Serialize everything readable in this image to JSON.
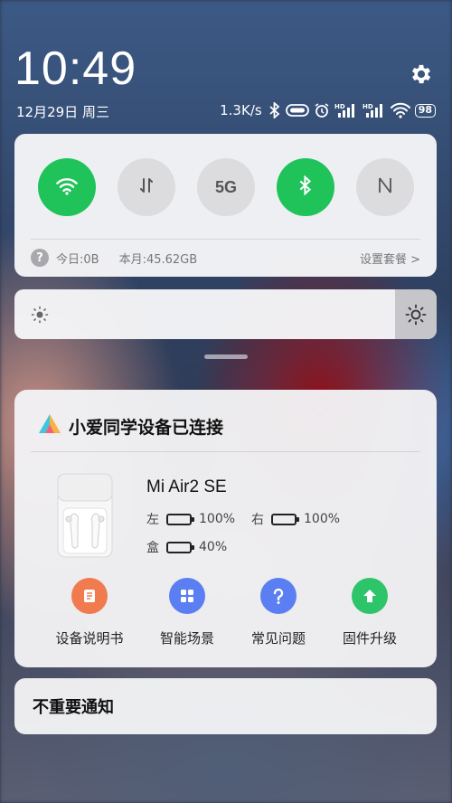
{
  "status": {
    "time": "10:49",
    "date": "12月29日 周三",
    "net_speed": "1.3K/s",
    "battery": "98",
    "icons": [
      "bluetooth-icon",
      "vpn-icon",
      "alarm-icon",
      "hd-signal-icon",
      "hd-signal-icon",
      "wifi-icon",
      "battery-icon"
    ]
  },
  "quick_settings": {
    "toggles": [
      {
        "name": "wifi",
        "icon": "wifi-icon",
        "on": true
      },
      {
        "name": "mobile-data",
        "icon": "data-arrows-icon",
        "on": false
      },
      {
        "name": "5g",
        "label": "5G",
        "on": false
      },
      {
        "name": "bluetooth",
        "icon": "bluetooth-icon",
        "on": true
      },
      {
        "name": "nfc",
        "icon": "nfc-icon",
        "on": false
      }
    ],
    "today_usage": "今日:0B",
    "month_usage": "本月:45.62GB",
    "plan_link": "设置套餐 >"
  },
  "notification": {
    "title": "小爱同学设备已连接",
    "device_name": "Mi Air2 SE",
    "left_label": "左",
    "left_value": "100%",
    "left_level": 1.0,
    "right_label": "右",
    "right_value": "100%",
    "right_level": 1.0,
    "case_label": "盒",
    "case_value": "40%",
    "case_level": 0.4,
    "actions": [
      {
        "label": "设备说明书",
        "icon": "manual-icon",
        "color": "#f07b4e"
      },
      {
        "label": "智能场景",
        "icon": "scenes-icon",
        "color": "#5b7ef2"
      },
      {
        "label": "常见问题",
        "icon": "question-icon",
        "color": "#5b7ef2"
      },
      {
        "label": "固件升级",
        "icon": "upgrade-icon",
        "color": "#2ec46a"
      }
    ]
  },
  "unimportant": {
    "label": "不重要通知"
  },
  "colors": {
    "accent_green": "#1fc35a",
    "card_bg": "#f2f2f4"
  }
}
